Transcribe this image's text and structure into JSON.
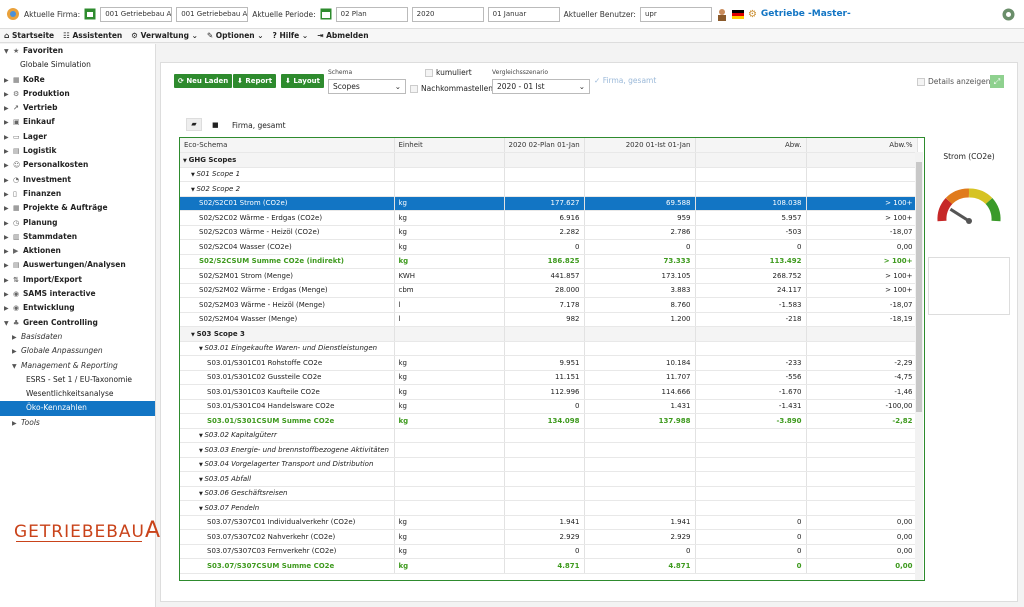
{
  "topbar": {
    "firma_label": "Aktuelle Firma:",
    "firma_code": "001 Getriebebau AG",
    "firma_name": "001 Getriebebau AG",
    "periode_label": "Aktuelle Periode:",
    "periode": "02 Plan",
    "jahr": "2020",
    "datum": "01 Januar",
    "benutzer_label": "Aktueller Benutzer:",
    "benutzer": "upr",
    "app_title": "Getriebe -Master-"
  },
  "menu": {
    "items": [
      "Startseite",
      "Assistenten",
      "Verwaltung",
      "Optionen",
      "Hilfe",
      "Abmelden"
    ]
  },
  "sidebar": {
    "items": [
      {
        "label": "Favoriten",
        "level": 0,
        "arrow": "▼",
        "bold": true,
        "icon": "★"
      },
      {
        "label": "Globale Simulation",
        "level": 2,
        "arrow": "",
        "bold": false,
        "icon": ""
      },
      {
        "label": "KoRe",
        "level": 0,
        "arrow": "▶",
        "bold": true,
        "icon": "▦"
      },
      {
        "label": "Produktion",
        "level": 0,
        "arrow": "▶",
        "bold": true,
        "icon": "⚙"
      },
      {
        "label": "Vertrieb",
        "level": 0,
        "arrow": "▶",
        "bold": true,
        "icon": "↗"
      },
      {
        "label": "Einkauf",
        "level": 0,
        "arrow": "▶",
        "bold": true,
        "icon": "▣"
      },
      {
        "label": "Lager",
        "level": 0,
        "arrow": "▶",
        "bold": true,
        "icon": "▭"
      },
      {
        "label": "Logistik",
        "level": 0,
        "arrow": "▶",
        "bold": true,
        "icon": "▤"
      },
      {
        "label": "Personalkosten",
        "level": 0,
        "arrow": "▶",
        "bold": true,
        "icon": "☺"
      },
      {
        "label": "Investment",
        "level": 0,
        "arrow": "▶",
        "bold": true,
        "icon": "◔"
      },
      {
        "label": "Finanzen",
        "level": 0,
        "arrow": "▶",
        "bold": true,
        "icon": "▯"
      },
      {
        "label": "Projekte & Aufträge",
        "level": 0,
        "arrow": "▶",
        "bold": true,
        "icon": "▦"
      },
      {
        "label": "Planung",
        "level": 0,
        "arrow": "▶",
        "bold": true,
        "icon": "◷"
      },
      {
        "label": "Stammdaten",
        "level": 0,
        "arrow": "▶",
        "bold": true,
        "icon": "▥"
      },
      {
        "label": "Aktionen",
        "level": 0,
        "arrow": "▶",
        "bold": true,
        "icon": "▶"
      },
      {
        "label": "Auswertungen/Analysen",
        "level": 0,
        "arrow": "▶",
        "bold": true,
        "icon": "▤"
      },
      {
        "label": "Import/Export",
        "level": 0,
        "arrow": "▶",
        "bold": true,
        "icon": "⇅"
      },
      {
        "label": "SAMS interactive",
        "level": 0,
        "arrow": "▶",
        "bold": true,
        "icon": "◉"
      },
      {
        "label": "Entwicklung",
        "level": 0,
        "arrow": "▶",
        "bold": true,
        "icon": "◉"
      },
      {
        "label": "Green Controlling",
        "level": 0,
        "arrow": "▼",
        "bold": true,
        "icon": "♣"
      },
      {
        "label": "Basisdaten",
        "level": 1,
        "arrow": "▶",
        "bold": false,
        "icon": ""
      },
      {
        "label": "Globale Anpassungen",
        "level": 1,
        "arrow": "▶",
        "bold": false,
        "icon": ""
      },
      {
        "label": "Management & Reporting",
        "level": 1,
        "arrow": "▼",
        "bold": false,
        "icon": ""
      },
      {
        "label": "ESRS - Set 1 / EU-Taxonomie",
        "level": 3,
        "arrow": "",
        "bold": false,
        "icon": ""
      },
      {
        "label": "Wesentlichkeitsanalyse",
        "level": 3,
        "arrow": "",
        "bold": false,
        "icon": ""
      },
      {
        "label": "Öko-Kennzahlen",
        "level": 3,
        "arrow": "",
        "bold": false,
        "icon": "",
        "selected": true
      },
      {
        "label": "Tools",
        "level": 1,
        "arrow": "▶",
        "bold": false,
        "icon": ""
      }
    ]
  },
  "logo": {
    "text": "GETRIEBEBAU",
    "suffix": "AG"
  },
  "toolbar": {
    "neu_laden": "Neu Laden",
    "report": "Report",
    "layout": "Layout",
    "schema_label": "Schema",
    "schema_value": "Scopes",
    "kumuliert": "kumuliert",
    "nachkomma": "Nachkommastellen",
    "vergleich_label": "Vergleichsszenario",
    "vergleich_value": "2020 - 01 Ist",
    "firma_gesamt_check": "Firma, gesamt",
    "details": "Details anzeigen"
  },
  "breadcrumb": {
    "text": "Firma, gesamt"
  },
  "table": {
    "headers": [
      "Eco-Schema",
      "Einheit",
      "2020 02-Plan 01-Jan",
      "2020 01-Ist 01-Jan",
      "Abw.",
      "Abw.%"
    ],
    "rows": [
      {
        "indent": 0,
        "toggle": "▼",
        "label": "GHG Scopes",
        "unit": "",
        "v1": "",
        "v2": "",
        "v3": "",
        "v4": "",
        "type": "grp"
      },
      {
        "indent": 1,
        "toggle": "▼",
        "label": "S01 Scope 1",
        "unit": "",
        "v1": "",
        "v2": "",
        "v3": "",
        "v4": "",
        "type": "sub"
      },
      {
        "indent": 1,
        "toggle": "▼",
        "label": "S02 Scope 2",
        "unit": "",
        "v1": "",
        "v2": "",
        "v3": "",
        "v4": "",
        "type": "sub"
      },
      {
        "indent": 2,
        "toggle": "",
        "label": "S02/S2C01 Strom (CO2e)",
        "unit": "kg",
        "v1": "177.627",
        "v2": "69.588",
        "v3": "108.038",
        "v4": "> 100+",
        "type": "sel"
      },
      {
        "indent": 2,
        "toggle": "",
        "label": "S02/S2C02 Wärme - Erdgas (CO2e)",
        "unit": "kg",
        "v1": "6.916",
        "v2": "959",
        "v3": "5.957",
        "v4": "> 100+",
        "type": ""
      },
      {
        "indent": 2,
        "toggle": "",
        "label": "S02/S2C03 Wärme - Heizöl (CO2e)",
        "unit": "kg",
        "v1": "2.282",
        "v2": "2.786",
        "v3": "-503",
        "v4": "-18,07",
        "type": ""
      },
      {
        "indent": 2,
        "toggle": "",
        "label": "S02/S2C04 Wasser (CO2e)",
        "unit": "kg",
        "v1": "0",
        "v2": "0",
        "v3": "0",
        "v4": "0,00",
        "type": ""
      },
      {
        "indent": 2,
        "toggle": "",
        "label": "S02/S2CSUM Summe CO2e (indirekt)",
        "unit": "kg",
        "v1": "186.825",
        "v2": "73.333",
        "v3": "113.492",
        "v4": "> 100+",
        "type": "sum"
      },
      {
        "indent": 2,
        "toggle": "",
        "label": "S02/S2M01 Strom (Menge)",
        "unit": "KWH",
        "v1": "441.857",
        "v2": "173.105",
        "v3": "268.752",
        "v4": "> 100+",
        "type": ""
      },
      {
        "indent": 2,
        "toggle": "",
        "label": "S02/S2M02 Wärme - Erdgas (Menge)",
        "unit": "cbm",
        "v1": "28.000",
        "v2": "3.883",
        "v3": "24.117",
        "v4": "> 100+",
        "type": ""
      },
      {
        "indent": 2,
        "toggle": "",
        "label": "S02/S2M03 Wärme - Heizöl (Menge)",
        "unit": "l",
        "v1": "7.178",
        "v2": "8.760",
        "v3": "-1.583",
        "v4": "-18,07",
        "type": ""
      },
      {
        "indent": 2,
        "toggle": "",
        "label": "S02/S2M04 Wasser (Menge)",
        "unit": "l",
        "v1": "982",
        "v2": "1.200",
        "v3": "-218",
        "v4": "-18,19",
        "type": ""
      },
      {
        "indent": 1,
        "toggle": "▼",
        "label": "S03 Scope 3",
        "unit": "",
        "v1": "",
        "v2": "",
        "v3": "",
        "v4": "",
        "type": "grp"
      },
      {
        "indent": 2,
        "toggle": "▼",
        "label": "S03.01 Eingekaufte Waren- und Dienstleistungen",
        "unit": "",
        "v1": "",
        "v2": "",
        "v3": "",
        "v4": "",
        "type": "sub"
      },
      {
        "indent": 3,
        "toggle": "",
        "label": "S03.01/S301C01 Rohstoffe CO2e",
        "unit": "kg",
        "v1": "9.951",
        "v2": "10.184",
        "v3": "-233",
        "v4": "-2,29",
        "type": ""
      },
      {
        "indent": 3,
        "toggle": "",
        "label": "S03.01/S301C02 Gussteile CO2e",
        "unit": "kg",
        "v1": "11.151",
        "v2": "11.707",
        "v3": "-556",
        "v4": "-4,75",
        "type": ""
      },
      {
        "indent": 3,
        "toggle": "",
        "label": "S03.01/S301C03 Kaufteile CO2e",
        "unit": "kg",
        "v1": "112.996",
        "v2": "114.666",
        "v3": "-1.670",
        "v4": "-1,46",
        "type": ""
      },
      {
        "indent": 3,
        "toggle": "",
        "label": "S03.01/S301C04 Handelsware CO2e",
        "unit": "kg",
        "v1": "0",
        "v2": "1.431",
        "v3": "-1.431",
        "v4": "-100,00",
        "type": ""
      },
      {
        "indent": 3,
        "toggle": "",
        "label": "S03.01/S301CSUM Summe CO2e",
        "unit": "kg",
        "v1": "134.098",
        "v2": "137.988",
        "v3": "-3.890",
        "v4": "-2,82",
        "type": "sum"
      },
      {
        "indent": 2,
        "toggle": "▼",
        "label": "S03.02 Kapitalgüterr",
        "unit": "",
        "v1": "",
        "v2": "",
        "v3": "",
        "v4": "",
        "type": "sub"
      },
      {
        "indent": 2,
        "toggle": "▼",
        "label": "S03.03 Energie- und brennstoffbezogene Aktivitäten",
        "unit": "",
        "v1": "",
        "v2": "",
        "v3": "",
        "v4": "",
        "type": "sub"
      },
      {
        "indent": 2,
        "toggle": "▼",
        "label": "S03.04 Vorgelagerter Transport und Distribution",
        "unit": "",
        "v1": "",
        "v2": "",
        "v3": "",
        "v4": "",
        "type": "sub"
      },
      {
        "indent": 2,
        "toggle": "▼",
        "label": "S03.05 Abfall",
        "unit": "",
        "v1": "",
        "v2": "",
        "v3": "",
        "v4": "",
        "type": "sub"
      },
      {
        "indent": 2,
        "toggle": "▼",
        "label": "S03.06 Geschäftsreisen",
        "unit": "",
        "v1": "",
        "v2": "",
        "v3": "",
        "v4": "",
        "type": "sub"
      },
      {
        "indent": 2,
        "toggle": "▼",
        "label": "S03.07 Pendeln",
        "unit": "",
        "v1": "",
        "v2": "",
        "v3": "",
        "v4": "",
        "type": "sub"
      },
      {
        "indent": 3,
        "toggle": "",
        "label": "S03.07/S307C01 Individualverkehr (CO2e)",
        "unit": "kg",
        "v1": "1.941",
        "v2": "1.941",
        "v3": "0",
        "v4": "0,00",
        "type": ""
      },
      {
        "indent": 3,
        "toggle": "",
        "label": "S03.07/S307C02 Nahverkehr (CO2e)",
        "unit": "kg",
        "v1": "2.929",
        "v2": "2.929",
        "v3": "0",
        "v4": "0,00",
        "type": ""
      },
      {
        "indent": 3,
        "toggle": "",
        "label": "S03.07/S307C03 Fernverkehr (CO2e)",
        "unit": "kg",
        "v1": "0",
        "v2": "0",
        "v3": "0",
        "v4": "0,00",
        "type": ""
      },
      {
        "indent": 3,
        "toggle": "",
        "label": "S03.07/S307CSUM Summe CO2e",
        "unit": "kg",
        "v1": "4.871",
        "v2": "4.871",
        "v3": "0",
        "v4": "0,00",
        "type": "sum"
      }
    ]
  },
  "gauge": {
    "title": "Strom (CO2e)",
    "min": "0",
    "max": "100",
    "level": 0.18
  },
  "colors": {
    "accent": "#2e8b2e",
    "selection": "#1275c4",
    "sum_text": "#3e9a1e",
    "title_blue": "#1275c4",
    "logo": "#c9431a"
  }
}
